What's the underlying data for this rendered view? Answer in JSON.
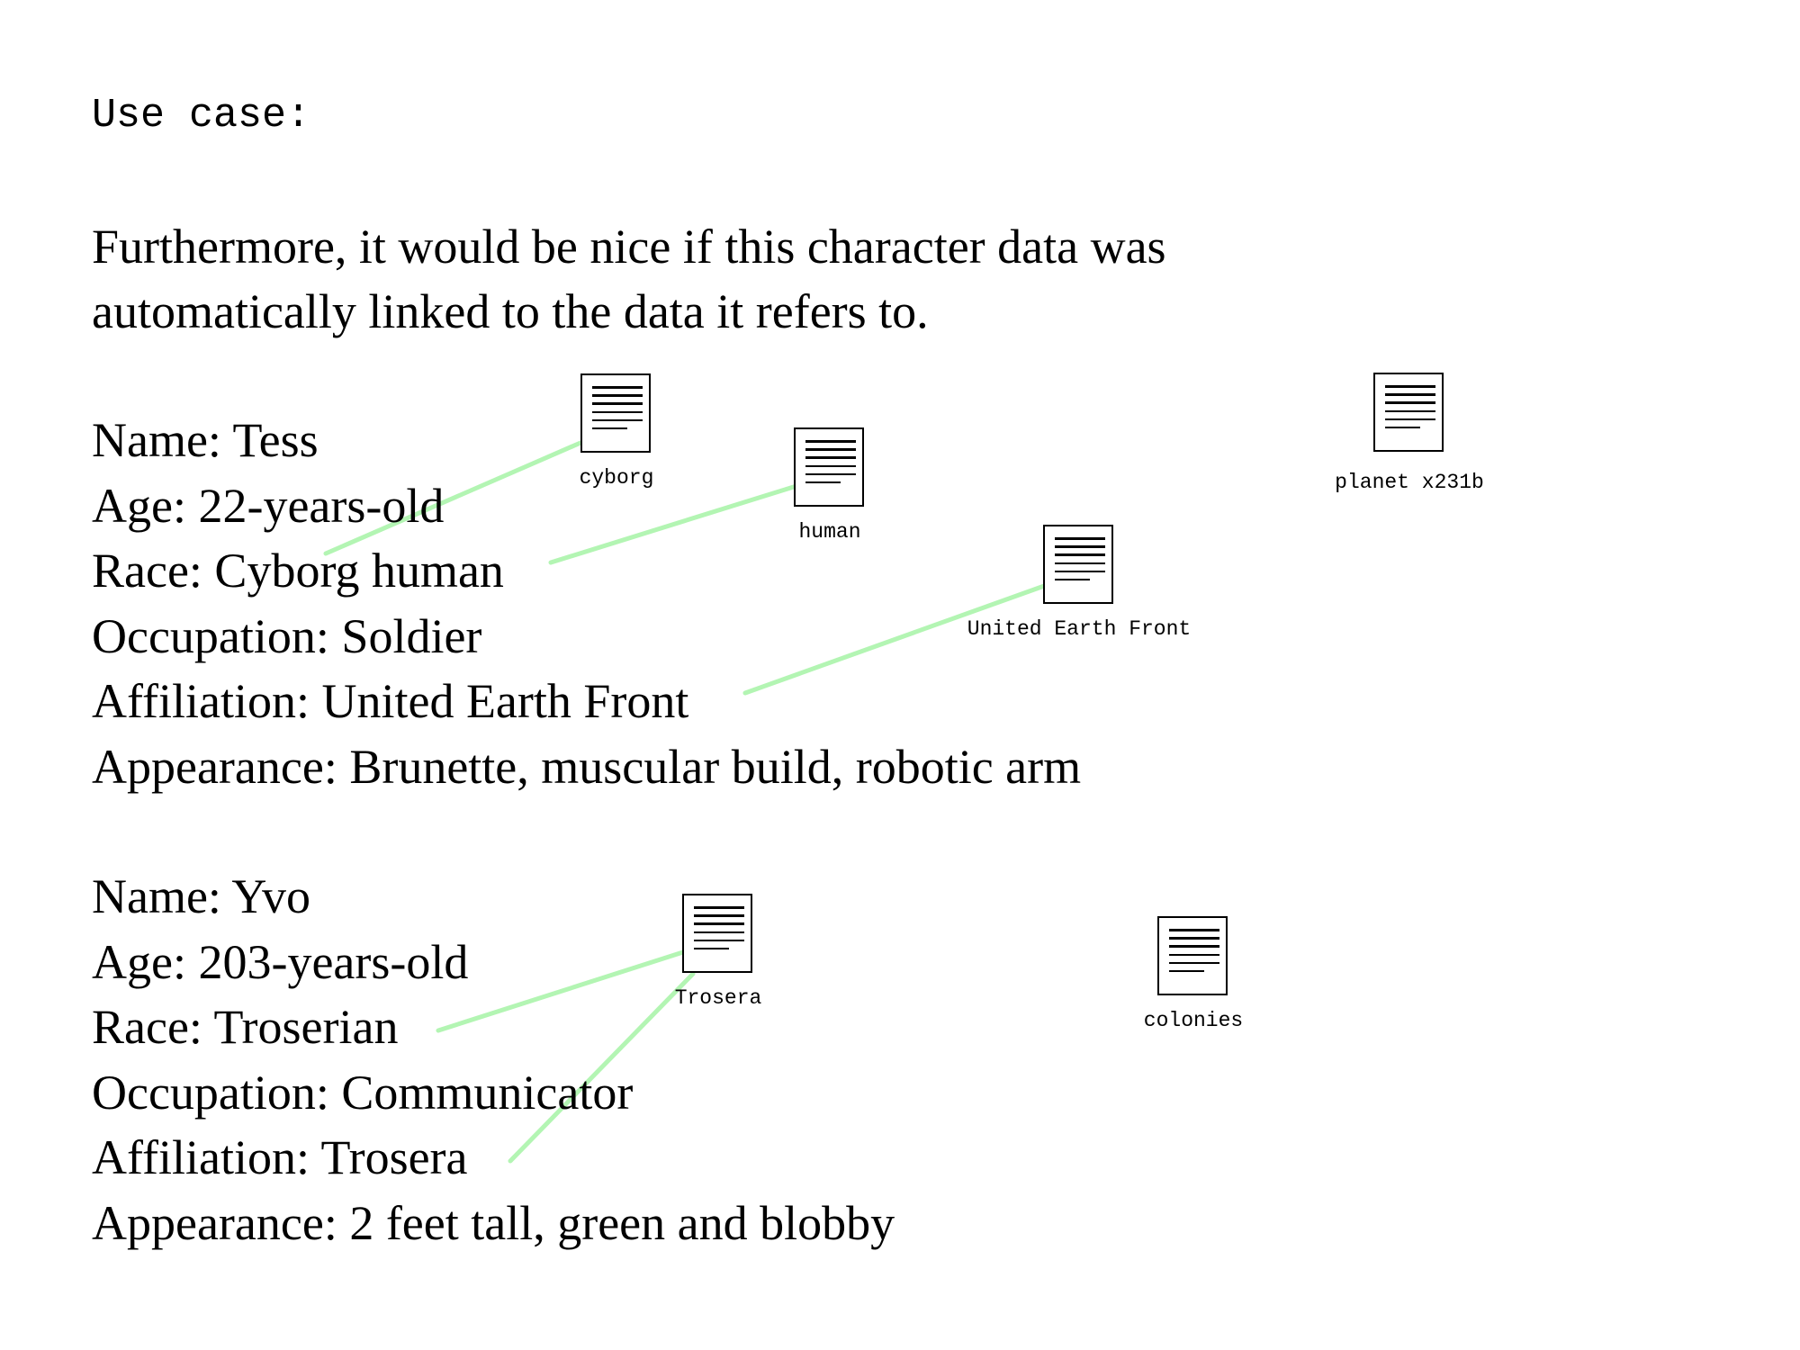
{
  "heading": "Use case:",
  "intro": {
    "line1": "Furthermore, it would be nice if this character data was",
    "line2": "automatically linked to the data it refers to."
  },
  "characters": [
    {
      "name": "Name: Tess",
      "age": "Age: 22-years-old",
      "race": "Race: Cyborg human",
      "occupation": "Occupation: Soldier",
      "affiliation": "Affiliation: United Earth Front",
      "appearance": "Appearance: Brunette, muscular build, robotic arm"
    },
    {
      "name": "Name: Yvo",
      "age": "Age: 203-years-old",
      "race": "Race: Troserian",
      "occupation": "Occupation: Communicator",
      "affiliation": "Affiliation: Trosera",
      "appearance": "Appearance: 2 feet tall, green and blobby"
    }
  ],
  "documents": [
    {
      "id": "cyborg",
      "label": "cyborg"
    },
    {
      "id": "human",
      "label": "human"
    },
    {
      "id": "planet",
      "label": "planet x231b"
    },
    {
      "id": "uef",
      "label": "United Earth Front"
    },
    {
      "id": "trosera",
      "label": "Trosera"
    },
    {
      "id": "colonies",
      "label": "colonies"
    }
  ],
  "link_color": "#b3f5b3"
}
